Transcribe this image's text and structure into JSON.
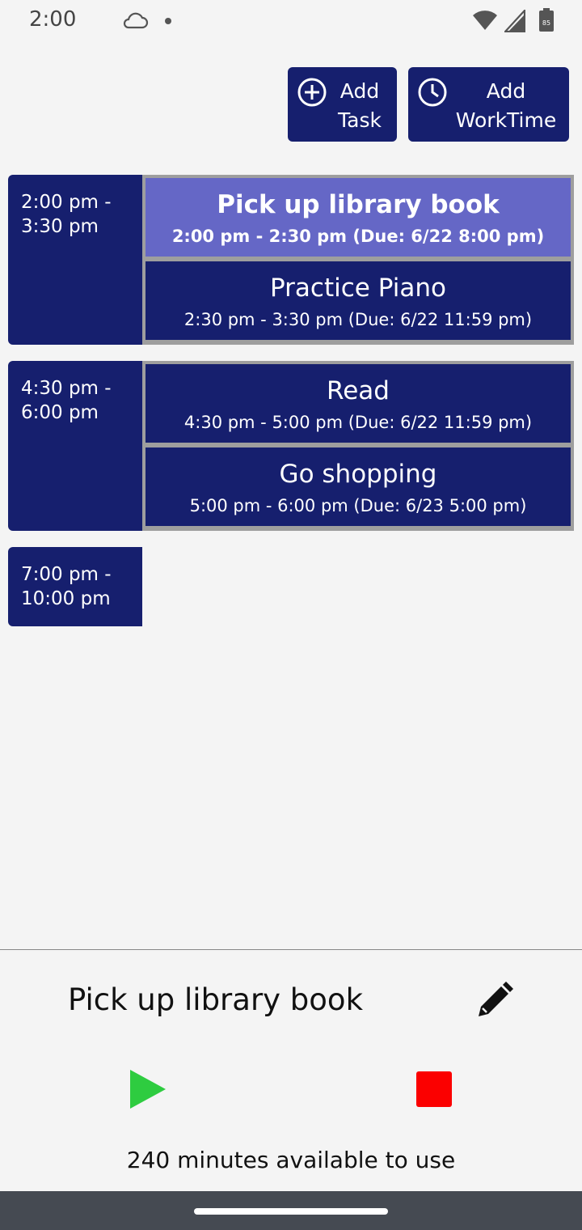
{
  "status_bar": {
    "time": "2:00",
    "icons": [
      "cloud-icon",
      "dot-icon",
      "wifi-icon",
      "signal-icon",
      "battery-icon"
    ],
    "battery_level": "85"
  },
  "toolbar": {
    "add_task_line1": "Add",
    "add_task_line2": "Task",
    "add_task_icon": "plus-circle-icon",
    "add_worktime_line1": "Add",
    "add_worktime_line2": "WorkTime",
    "add_worktime_icon": "clock-icon"
  },
  "colors": {
    "primary": "#161f6e",
    "selected": "#6567c6",
    "play": "#2ecc40",
    "stop": "#fb0000",
    "background": "#f4f4f4"
  },
  "worktimes": [
    {
      "start": "2:00 pm -",
      "end": "3:30 pm",
      "tasks": [
        {
          "name": "Pick up library book",
          "detail": "2:00 pm - 2:30 pm (Due: 6/22 8:00 pm)",
          "selected": true
        },
        {
          "name": "Practice Piano",
          "detail": "2:30 pm - 3:30 pm (Due: 6/22 11:59 pm)",
          "selected": false
        }
      ]
    },
    {
      "start": "4:30 pm -",
      "end": "6:00 pm",
      "tasks": [
        {
          "name": "Read",
          "detail": "4:30 pm - 5:00 pm (Due: 6/22 11:59 pm)",
          "selected": false
        },
        {
          "name": "Go shopping",
          "detail": "5:00 pm - 6:00 pm (Due: 6/23 5:00 pm)",
          "selected": false
        }
      ]
    },
    {
      "start": "7:00 pm -",
      "end": "10:00 pm",
      "tasks": []
    }
  ],
  "bottom": {
    "current_task": "Pick up library book",
    "minutes_available": "240 minutes available to use",
    "icons": [
      "pencil-icon",
      "play-icon",
      "stop-icon"
    ]
  }
}
